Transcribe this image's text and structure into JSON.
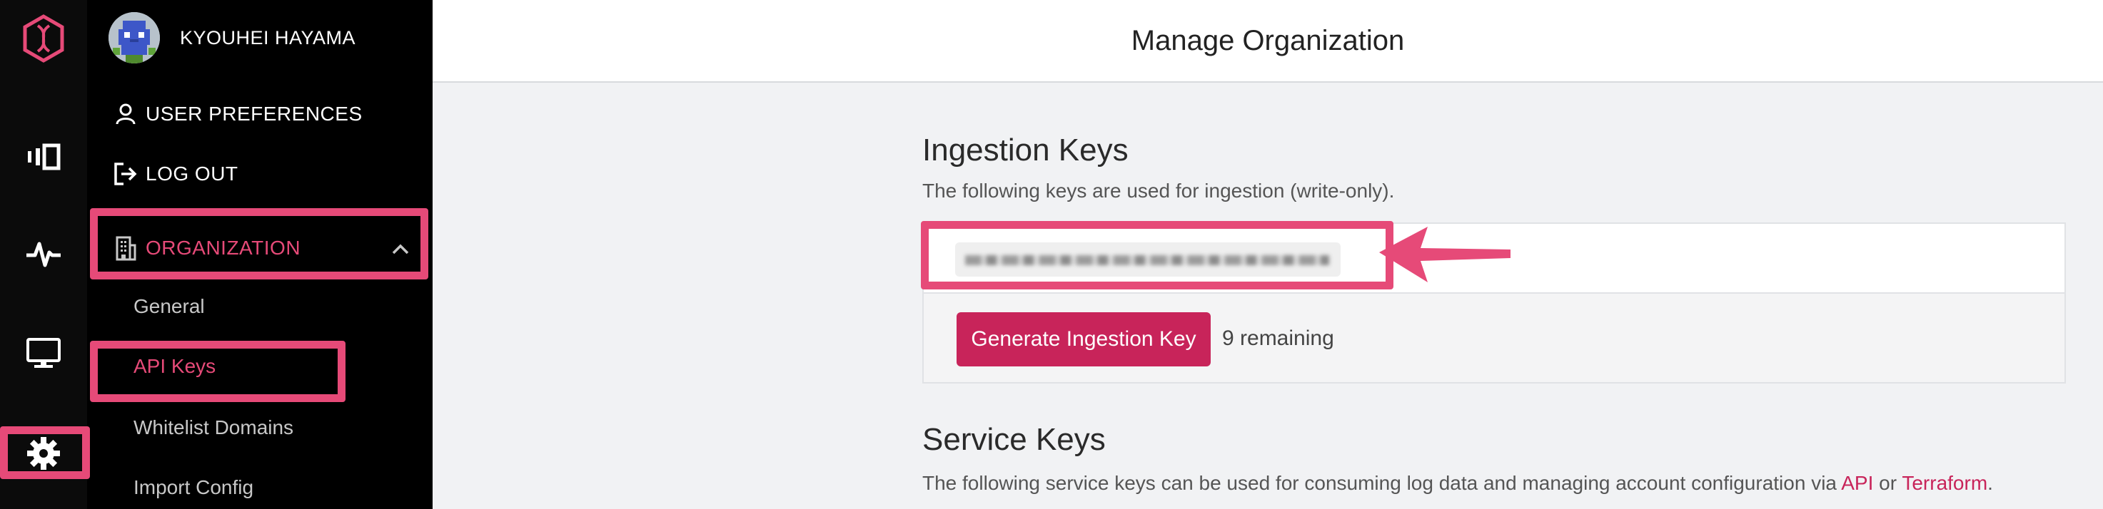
{
  "user": {
    "name": "KYOUHEI HAYAMA"
  },
  "menu": {
    "preferences": "USER PREFERENCES",
    "logout": "LOG OUT",
    "organization": "ORGANIZATION",
    "sub_items": [
      "General",
      "API Keys",
      "Whitelist Domains",
      "Import Config"
    ]
  },
  "rail_icons": [
    "logo-icon",
    "views-icon",
    "pulse-icon",
    "monitor-icon",
    "gear-icon"
  ],
  "header": {
    "title": "Manage Organization"
  },
  "ingestion": {
    "title": "Ingestion Keys",
    "description": "The following keys are used for ingestion (write-only).",
    "button": "Generate Ingestion Key",
    "remaining": "9 remaining"
  },
  "service": {
    "title": "Service Keys",
    "description_prefix": "The following service keys can be used for consuming log data and managing account configuration via",
    "link_api": "API",
    "or": "or",
    "link_terraform": "Terraform",
    "suffix": "."
  },
  "colors": {
    "accent": "#e64a78",
    "button": "#c8245a",
    "sidebar": "#000000"
  }
}
